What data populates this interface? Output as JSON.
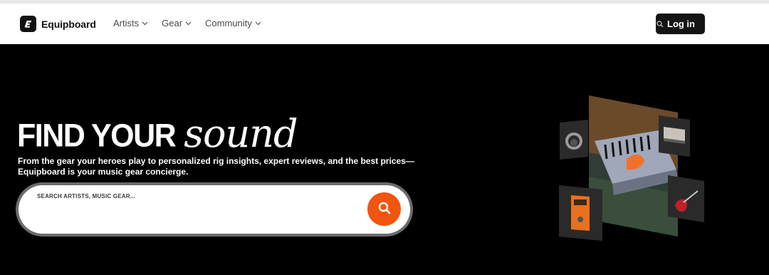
{
  "header": {
    "brand": "Equipboard",
    "nav": [
      {
        "label": "Artists"
      },
      {
        "label": "Gear"
      },
      {
        "label": "Community"
      }
    ],
    "login_label": "Log in"
  },
  "hero": {
    "headline_main": "FIND YOUR",
    "headline_script": "sound",
    "subtitle": "From the gear your heroes play to personalized rig insights, expert reviews, and the best prices—Equipboard is your music gear concierge.",
    "search_placeholder": "SEARCH ARTISTS, MUSIC GEAR..."
  },
  "colors": {
    "hero_bg": "#000000",
    "accent": "#f2550f",
    "header_bg": "#ffffff"
  },
  "icons": [
    "logo-icon",
    "chevron-down-icon",
    "search-icon",
    "headphones-icon",
    "amplifier-icon",
    "guitar-icon",
    "pedal-icon",
    "equalizer-pedal-icon"
  ]
}
